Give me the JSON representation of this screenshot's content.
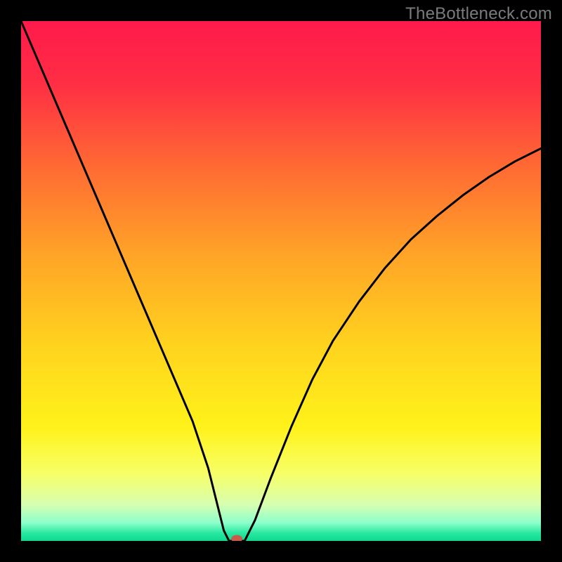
{
  "watermark": "TheBottleneck.com",
  "chart_data": {
    "type": "line",
    "title": "",
    "xlabel": "",
    "ylabel": "",
    "xlim": [
      0,
      100
    ],
    "ylim": [
      0,
      100
    ],
    "grid": false,
    "legend": false,
    "background_gradient": {
      "stops": [
        {
          "offset": 0.0,
          "color": "#ff1a4b"
        },
        {
          "offset": 0.12,
          "color": "#ff2e44"
        },
        {
          "offset": 0.28,
          "color": "#ff6a33"
        },
        {
          "offset": 0.45,
          "color": "#ffa427"
        },
        {
          "offset": 0.62,
          "color": "#ffd21e"
        },
        {
          "offset": 0.78,
          "color": "#fff21a"
        },
        {
          "offset": 0.87,
          "color": "#f7ff66"
        },
        {
          "offset": 0.93,
          "color": "#d7ffb0"
        },
        {
          "offset": 0.965,
          "color": "#8dffcc"
        },
        {
          "offset": 0.985,
          "color": "#27e8a0"
        },
        {
          "offset": 1.0,
          "color": "#0fd98f"
        }
      ]
    },
    "series": [
      {
        "name": "bottleneck-curve",
        "color": "#000000",
        "stroke_width": 3,
        "x": [
          0,
          3,
          6,
          9,
          12,
          15,
          18,
          21,
          24,
          27,
          30,
          33,
          36,
          38,
          39,
          40,
          41,
          43,
          45,
          48,
          52,
          56,
          60,
          65,
          70,
          75,
          80,
          85,
          90,
          95,
          100
        ],
        "y": [
          100,
          93,
          86,
          79,
          72,
          65,
          58,
          51,
          44,
          37,
          30,
          23,
          14,
          6,
          2,
          0,
          0,
          0,
          4,
          12,
          22,
          31,
          38.5,
          46,
          52.5,
          58,
          62.5,
          66.5,
          70,
          73,
          75.5
        ]
      }
    ],
    "marker": {
      "name": "min-point-marker",
      "x": 41.5,
      "y": 0,
      "rx": 8,
      "ry": 5.5,
      "fill": "#cc5a4a"
    }
  }
}
